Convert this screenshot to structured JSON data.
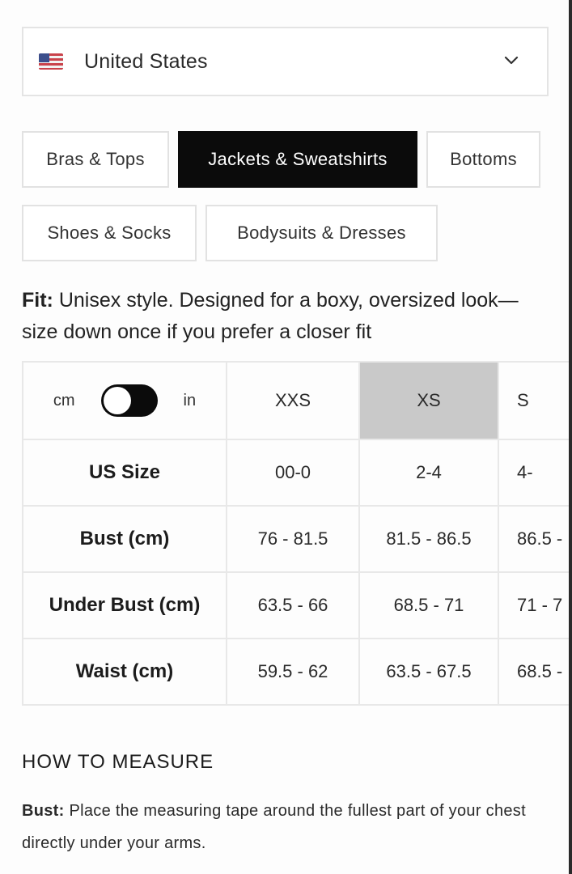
{
  "country_select": {
    "flag_icon": "us-flag-icon",
    "value": "United States",
    "chevron_icon": "chevron-down-icon"
  },
  "tabs": [
    {
      "label": "Bras & Tops",
      "active": false
    },
    {
      "label": "Jackets & Sweatshirts",
      "active": true
    },
    {
      "label": "Bottoms",
      "active": false
    },
    {
      "label": "Shoes & Socks",
      "active": false
    },
    {
      "label": "Bodysuits & Dresses",
      "active": false
    }
  ],
  "fit": {
    "label": "Fit:",
    "text": "Unisex style. Designed for a boxy, oversized look—size down once if you prefer a closer fit"
  },
  "unit_toggle": {
    "left": "cm",
    "right": "in",
    "selected": "cm"
  },
  "size_table": {
    "sizes": [
      "XXS",
      "XS",
      "S"
    ],
    "selected_size": "XS",
    "rows": [
      {
        "label": "US Size",
        "values": [
          "00-0",
          "2-4",
          "4-"
        ]
      },
      {
        "label": "Bust (cm)",
        "values": [
          "76 - 81.5",
          "81.5 - 86.5",
          "86.5 -"
        ]
      },
      {
        "label": "Under Bust (cm)",
        "values": [
          "63.5 - 66",
          "68.5 - 71",
          "71 - 7"
        ]
      },
      {
        "label": "Waist (cm)",
        "values": [
          "59.5 - 62",
          "63.5 - 67.5",
          "68.5 -"
        ]
      }
    ]
  },
  "how_to_measure": {
    "title": "HOW TO MEASURE",
    "bust_label": "Bust:",
    "bust_text": "Place the measuring tape around the fullest part of your chest directly under your arms."
  },
  "colors": {
    "active_tab": "#0b0b0b",
    "selected_size_bg": "#c9c9c9",
    "border": "#e4e4e4"
  }
}
